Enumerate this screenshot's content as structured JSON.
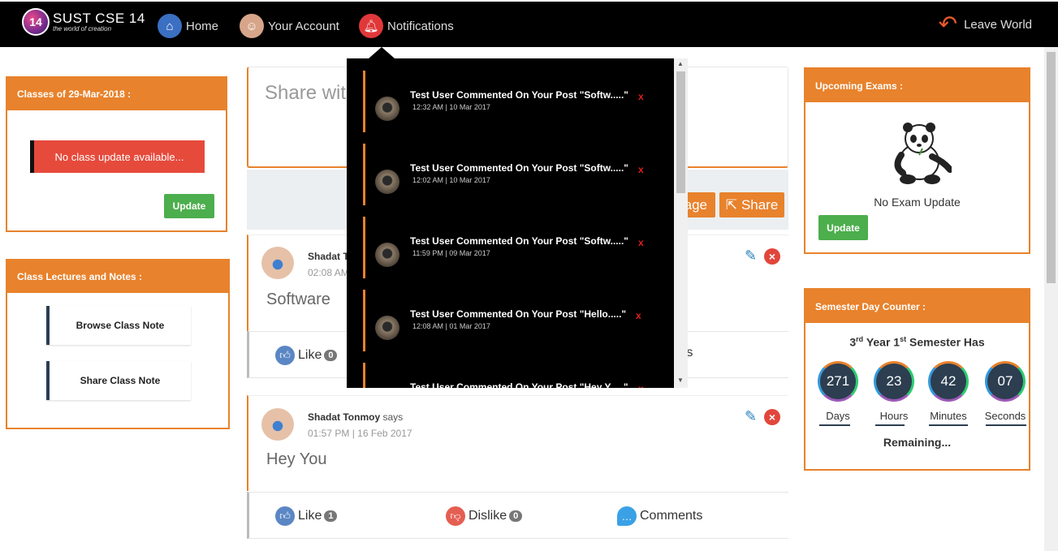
{
  "nav": {
    "logo_title": "SUST CSE 14",
    "logo_sub": "the world of creation",
    "logo_mark": "14",
    "home": "Home",
    "account": "Your Account",
    "notifications": "Notifications",
    "leave": "Leave World"
  },
  "classes": {
    "title": "Classes of 29-Mar-2018 :",
    "no_update": "No class update available...",
    "update_btn": "Update"
  },
  "lectures": {
    "title": "Class Lectures and Notes :",
    "browse": "Browse Class Note",
    "share": "Share Class Note"
  },
  "share": {
    "placeholder": "Share with",
    "image_btn": "age",
    "share_btn": "Share"
  },
  "posts": [
    {
      "author": "Shadat T",
      "says": "",
      "time": "02:08 AM",
      "body": "Software",
      "like": "Like",
      "like_count": "0",
      "comments": "nts"
    },
    {
      "author": "Shadat Tonmoy",
      "says": "says",
      "time": "01:57 PM | 16 Feb 2017",
      "body": "Hey You",
      "like": "Like",
      "like_count": "1",
      "dislike": "Dislike",
      "dislike_count": "0",
      "comments": "Comments"
    }
  ],
  "notifications": [
    {
      "text": "Test User Commented On Your Post \"Softw.....\"",
      "time": "12:32 AM | 10 Mar 2017"
    },
    {
      "text": "Test User Commented On Your Post \"Softw.....\"",
      "time": "12:02 AM | 10 Mar 2017"
    },
    {
      "text": "Test User Commented On Your Post \"Softw.....\"",
      "time": "11:59 PM | 09 Mar 2017"
    },
    {
      "text": "Test User Commented On Your Post \"Hello.....\"",
      "time": "12:08 AM | 01 Mar 2017"
    },
    {
      "text": "Test User Commented On Your Post \"Hey Y.....\"",
      "time": ""
    }
  ],
  "notif_close": "x",
  "exams": {
    "title": "Upcoming Exams :",
    "no_exam": "No Exam Update",
    "update_btn": "Update"
  },
  "counter": {
    "title": "Semester Day Counter :",
    "year": "3",
    "year_sup": "rd",
    "year_word": "Year",
    "sem": "1",
    "sem_sup": "st",
    "sem_word": "Semester Has",
    "days": "271",
    "hours": "23",
    "minutes": "42",
    "seconds": "07",
    "days_label": "Days",
    "hours_label": "Hours",
    "minutes_label": "Minutes",
    "seconds_label": "Seconds",
    "remaining": "Remaining..."
  },
  "colors": {
    "accent": "#e8822c",
    "danger": "#e64a3b",
    "success": "#4cae4c",
    "dark": "#2c3e50"
  }
}
